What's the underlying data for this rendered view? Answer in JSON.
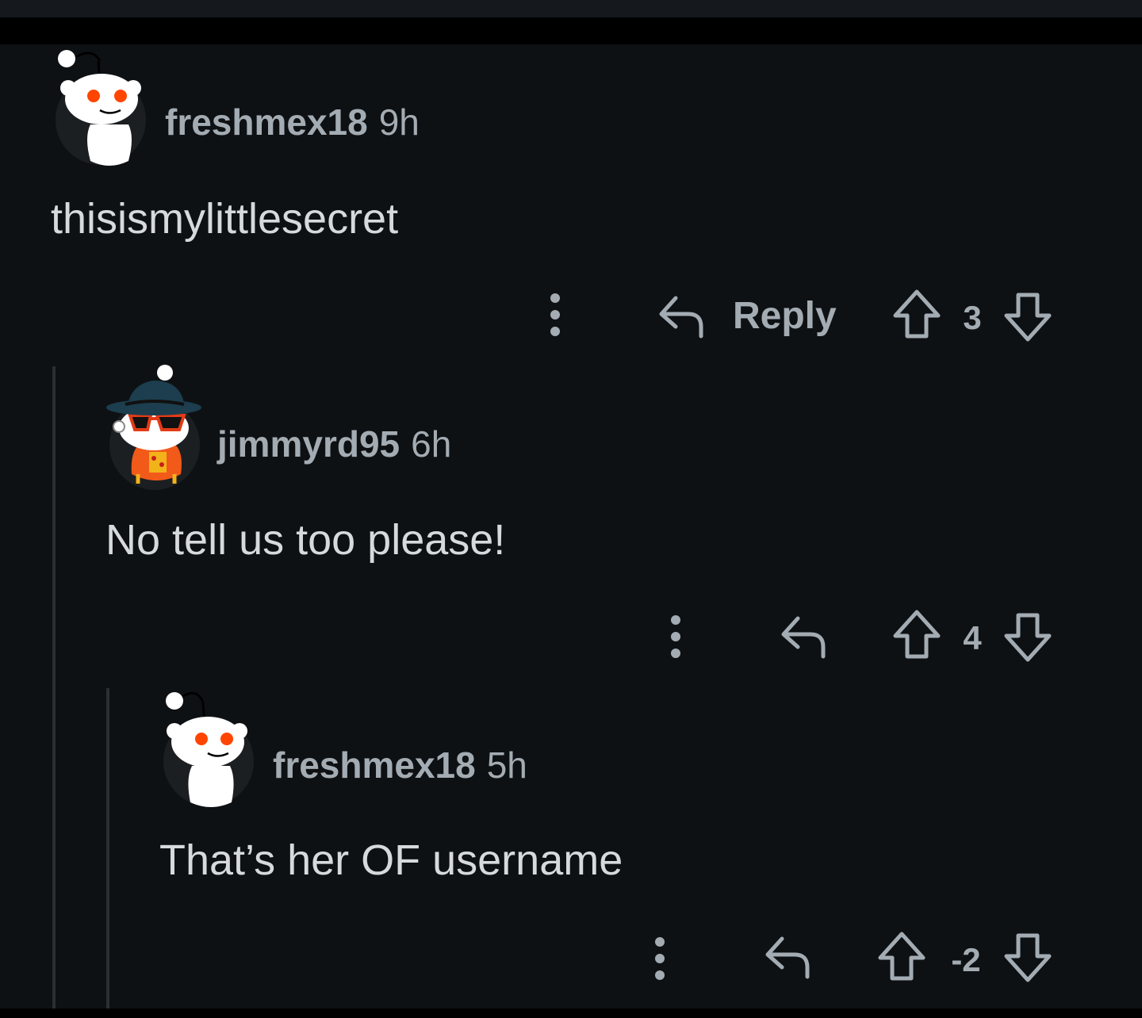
{
  "comments": [
    {
      "username": "freshmex18",
      "time": "9h",
      "text": "thisismylittlesecret",
      "reply_label": "Reply",
      "score": "3",
      "avatar": "reddit-snoo-avatar-icon"
    },
    {
      "username": "jimmyrd95",
      "time": "6h",
      "text": "No tell us too please!",
      "score": "4",
      "avatar": "reddit-snoo-hat-sunglasses-avatar-icon"
    },
    {
      "username": "freshmex18",
      "time": "5h",
      "text": "That’s her OF username",
      "score": "-2",
      "avatar": "reddit-snoo-avatar-icon"
    }
  ],
  "colors": {
    "background": "#0e1114",
    "meta_text": "#a4acb3",
    "body_text": "#d7dadc",
    "snoo_eye": "#ff4500",
    "thread_line": "#2a2f34"
  }
}
